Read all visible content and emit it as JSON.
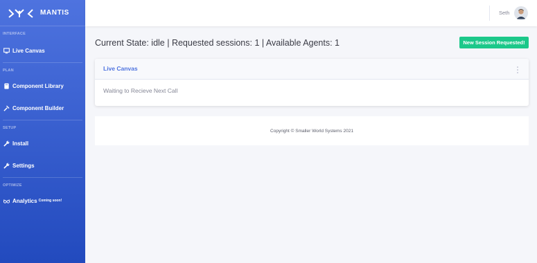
{
  "brand": {
    "name": "MANTIS",
    "logo_icon": "mantis-logo"
  },
  "sidebar": {
    "sections": [
      {
        "heading": "INTERFACE",
        "items": [
          {
            "label": "Live Canvas",
            "icon": "monitor-icon",
            "badge": ""
          }
        ]
      },
      {
        "heading": "PLAN",
        "items": [
          {
            "label": "Component Library",
            "icon": "book-icon",
            "badge": ""
          },
          {
            "label": "Component Builder",
            "icon": "hammer-icon",
            "badge": ""
          }
        ]
      },
      {
        "heading": "SETUP",
        "items": [
          {
            "label": "Install",
            "icon": "wrench-icon",
            "badge": ""
          },
          {
            "label": "Settings",
            "icon": "wrench-icon",
            "badge": ""
          }
        ]
      },
      {
        "heading": "OPTIMIZE",
        "items": [
          {
            "label": "Analytics",
            "icon": "glasses-icon",
            "badge": "Coming soon!"
          }
        ]
      }
    ]
  },
  "topbar": {
    "username": "Seth",
    "avatar_icon": "user-avatar"
  },
  "main": {
    "status_heading": "Current State: idle | Requested sessions: 1 | Available Agents: 1",
    "new_session_button": "New Session Requested!",
    "card": {
      "title": "Live Canvas",
      "menu_icon": "vertical-ellipsis-icon",
      "body": "Waiting to Recieve Next Call"
    },
    "footer": "Copyright © Smaller World Systems 2021"
  },
  "colors": {
    "sidebar_top": "#4e73df",
    "sidebar_bottom": "#224abe",
    "success": "#1cc88a",
    "primary": "#4e73df"
  }
}
